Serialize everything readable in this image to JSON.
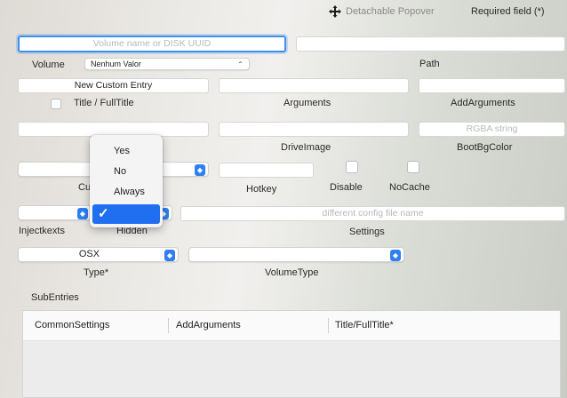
{
  "toolbar": {
    "detachable_popover": "Detachable Popover",
    "required_field": "Required field (*)"
  },
  "row1": {
    "volume_placeholder": "Volume name or DISK UUID",
    "path_value": "",
    "volume_label": "Volume",
    "volume_select": "Nenhum Valor",
    "path_label": "Path"
  },
  "row2": {
    "title_value": "New Custom Entry",
    "title_label": "Title / FullTitle",
    "arguments_label": "Arguments",
    "addarguments_label": "AddArguments"
  },
  "row3": {
    "driveimage_label": "DriveImage",
    "bootbgcolor_placeholder": "RGBA string",
    "bootbgcolor_label": "BootBgColor"
  },
  "row4": {
    "custom_label": "Cu",
    "hotkey_label": "Hotkey",
    "disable_label": "Disable",
    "nocache_label": "NoCache"
  },
  "row5": {
    "injectkexts_label": "Injectkexts",
    "hidden_label": "Hidden",
    "settings_placeholder": "different config file name",
    "settings_label": "Settings"
  },
  "row6": {
    "type_value": "OSX",
    "type_label": "Type*",
    "volumetype_label": "VolumeType"
  },
  "popup_menu": {
    "items": [
      "Yes",
      "No",
      "Always",
      ""
    ],
    "selected_index": 3
  },
  "subentries": {
    "label": "SubEntries",
    "columns": [
      "CommonSettings",
      "AddArguments",
      "Title/FullTitle*"
    ]
  },
  "colors": {
    "accent": "#2f7ff0",
    "focus_ring": "#3d8ff0",
    "menu_selection": "#1f6ff0"
  },
  "icons": {
    "move": "move-icon",
    "stepper": "stepper-icon",
    "checkmark": "checkmark-icon"
  }
}
